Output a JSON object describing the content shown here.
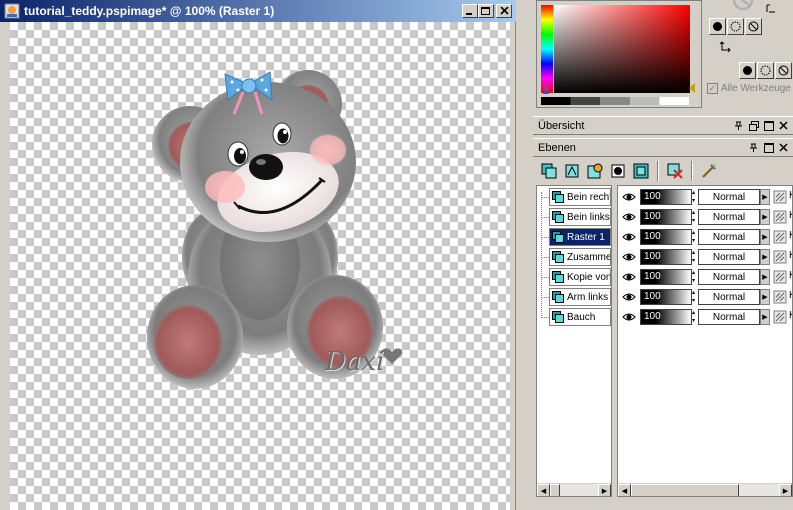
{
  "window": {
    "title": "tutorial_teddy.pspimage* @ 100% (Raster 1)",
    "buttons": [
      "minimize",
      "maximize",
      "close"
    ]
  },
  "canvas": {
    "signature": "Daxi"
  },
  "materials": {
    "alle_werkzeuge": "Alle Werkzeuge"
  },
  "palettes": {
    "overview_title": "Übersicht",
    "layers_title": "Ebenen"
  },
  "layers": [
    {
      "name": "Bein recht",
      "opacity": "100",
      "blend": "Normal",
      "suffix": "K"
    },
    {
      "name": "Bein links",
      "opacity": "100",
      "blend": "Normal",
      "suffix": "K"
    },
    {
      "name": "Raster 1",
      "opacity": "100",
      "blend": "Normal",
      "suffix": "K",
      "selected": true
    },
    {
      "name": "Zusammen",
      "opacity": "100",
      "blend": "Normal",
      "suffix": "K"
    },
    {
      "name": "Kopie von",
      "opacity": "100",
      "blend": "Normal",
      "suffix": "K"
    },
    {
      "name": "Arm links",
      "opacity": "100",
      "blend": "Normal",
      "suffix": "K"
    },
    {
      "name": "Bauch",
      "opacity": "100",
      "blend": "Normal",
      "suffix": "K"
    }
  ],
  "colors": {
    "title_start": "#0a246a",
    "title_end": "#a6caf0",
    "selection": "#0a246a",
    "ear_inner": "#b06060",
    "bow": "#5ba8e0"
  }
}
